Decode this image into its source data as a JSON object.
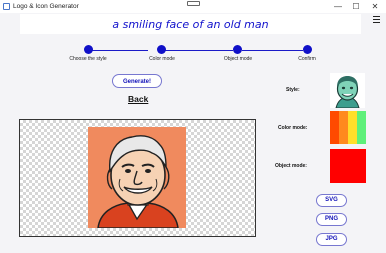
{
  "window": {
    "title": "Logo & Icon Generator",
    "minimize": "—",
    "maximize": "☐",
    "close": "✕"
  },
  "prompt": {
    "text": "a smiling face of an old man"
  },
  "steps": [
    {
      "label": "Choose the style",
      "done": true
    },
    {
      "label": "Color mode",
      "done": true
    },
    {
      "label": "Object mode",
      "done": true
    },
    {
      "label": "Confirm",
      "done": true
    }
  ],
  "actions": {
    "generate_label": "Generate!",
    "back_label": "Back"
  },
  "preview": {
    "image": "old-man-smiling-face-illustration"
  },
  "settings": {
    "style_label": "Style:",
    "color_mode_label": "Color mode:",
    "object_mode_label": "Object mode:",
    "style_image": "green-old-man-face-icon",
    "color_palette": [
      "#ff4a00",
      "#ff8a1e",
      "#ffdf2a",
      "#5ef07a"
    ],
    "object_color": "#ff0000"
  },
  "export": {
    "svg_label": "SVG",
    "png_label": "PNG",
    "jpg_label": "JPG"
  },
  "colors": {
    "accent": "#1010c8",
    "prompt_text": "#1111cc",
    "background": "#f4f4f7"
  }
}
